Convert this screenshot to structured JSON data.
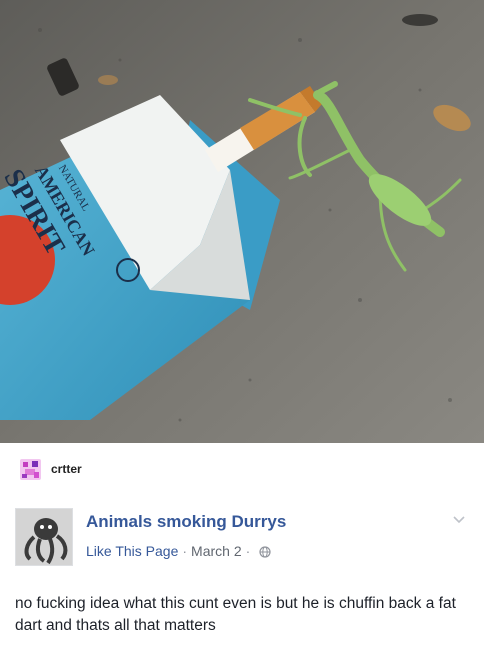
{
  "photo": {
    "package_lines": [
      "NATURAL",
      "AMERICAN",
      "SPIRIT"
    ],
    "icon": "mantis-smoking-cigarette-photo"
  },
  "reblog": {
    "username": "crtter",
    "avatar_icon": "pink-pixel-avatar"
  },
  "post": {
    "page_name": "Animals smoking Durrys",
    "like_link": "Like This Page",
    "separator": "·",
    "date": "March 2",
    "audience_icon": "globe-icon",
    "menu_icon": "chevron-down-icon",
    "text": "no fucking idea what this cunt even is but he is chuffin back a fat dart and thats all that matters"
  },
  "colors": {
    "link_blue": "#365899",
    "meta_gray": "#616770",
    "text": "#1d2129"
  }
}
